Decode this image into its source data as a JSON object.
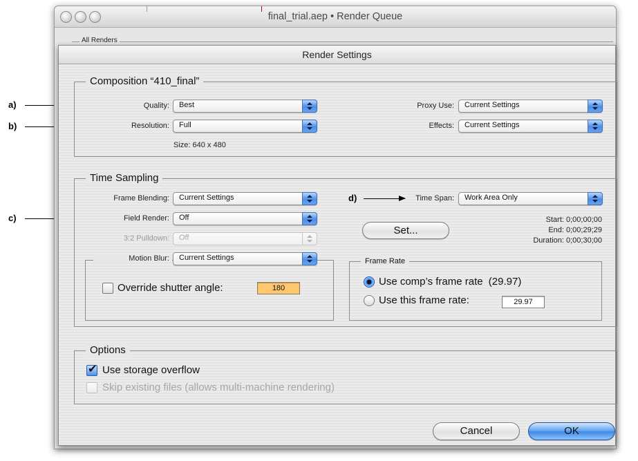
{
  "annotations": {
    "a": "a)",
    "b": "b)",
    "c": "c)",
    "d": "d)"
  },
  "window": {
    "title": "final_trial.aep • Render Queue",
    "all_renders": "All Renders"
  },
  "sheet": {
    "title": "Render Settings"
  },
  "composition": {
    "title": "Composition “410_final”",
    "quality": {
      "label": "Quality:",
      "value": "Best"
    },
    "resolution": {
      "label": "Resolution:",
      "value": "Full"
    },
    "size": "Size: 640 x 480",
    "proxy_use": {
      "label": "Proxy Use:",
      "value": "Current Settings"
    },
    "effects": {
      "label": "Effects:",
      "value": "Current Settings"
    }
  },
  "time_sampling": {
    "title": "Time Sampling",
    "frame_blending": {
      "label": "Frame Blending:",
      "value": "Current Settings"
    },
    "field_render": {
      "label": "Field Render:",
      "value": "Off"
    },
    "pulldown": {
      "label": "3:2 Pulldown:",
      "value": "Off"
    },
    "motion_blur": {
      "label": "Motion Blur:",
      "value": "Current Settings"
    },
    "override_shutter": {
      "label": "Override shutter angle:",
      "value": "180",
      "checked": false
    },
    "time_span": {
      "label": "Time Span:",
      "value": "Work Area Only"
    },
    "set_button": "Set...",
    "start": "Start: 0;00;00;00",
    "end": "End: 0;00;29;29",
    "duration": "Duration: 0;00;30;00",
    "frame_rate": {
      "title": "Frame Rate",
      "use_comp": "Use comp’s frame rate",
      "comp_rate": "(29.97)",
      "use_this": "Use this frame rate:",
      "this_rate": "29.97",
      "selected": "comp"
    }
  },
  "options": {
    "title": "Options",
    "storage_overflow": {
      "label": "Use storage overflow",
      "checked": true
    },
    "skip_existing": {
      "label": "Skip existing files (allows multi-machine rendering)",
      "enabled": false
    }
  },
  "buttons": {
    "cancel": "Cancel",
    "ok": "OK"
  },
  "colors": {
    "accent": "#4d8ee6",
    "field_highlight": "#ffc870"
  }
}
